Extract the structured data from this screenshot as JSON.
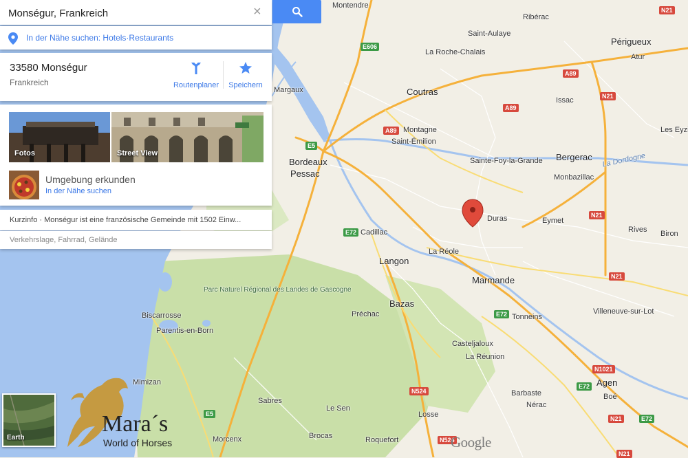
{
  "search": {
    "value": "Monségur, Frankreich",
    "clear_icon": "×"
  },
  "nearby": {
    "text": "In der Nähe suchen: Hotels·Restaurants"
  },
  "place": {
    "title": "33580 Monségur",
    "subtitle": "Frankreich",
    "route_label": "Routenplaner",
    "save_label": "Speichern"
  },
  "media": {
    "photos_label": "Fotos",
    "streetview_label": "Street View",
    "explore_title": "Umgebung erkunden",
    "explore_link": "In der Nähe suchen"
  },
  "info": {
    "text": "Kurzinfo · Monségur ist eine französische Gemeinde mit 1502 Einw..."
  },
  "extra": {
    "text": "Verkehrslage, Fahrrad, Gelände"
  },
  "earth": {
    "label": "Earth"
  },
  "google": {
    "text": "Google"
  },
  "watermark": {
    "title": "Mara´s",
    "subtitle": "World of Horses"
  },
  "map": {
    "cities": {
      "montendre": "Montendre",
      "riberac": "Ribérac",
      "saint_aulaye": "Saint-Aulaye",
      "perigueux": "Périgueux",
      "atur": "Atur",
      "la_roche_chalais": "La Roche-Chalais",
      "margaux": "Margaux",
      "coutras": "Coutras",
      "issac": "Issac",
      "les_eyzies": "Les Eyzi",
      "montagne": "Montagne",
      "saint_emilion": "Saint-Émilion",
      "bordeaux": "Bordeaux",
      "pessac": "Pessac",
      "sainte_foy": "Sainte-Foy-la-Grande",
      "bergerac": "Bergerac",
      "monbazillac": "Monbazillac",
      "la_dordogne": "La Dordogne",
      "duras": "Duras",
      "eymet": "Eymet",
      "cadillac": "Cadillac",
      "rives": "Rives",
      "biron": "Biron",
      "la_reole": "La Réole",
      "langon": "Langon",
      "marmande": "Marmande",
      "parc": "Parc Naturel Régional des Landes de Gascogne",
      "bazas": "Bazas",
      "tonneins": "Tonneins",
      "villeneuve": "Villeneuve-sur-Lot",
      "biscarrosse": "Biscarrosse",
      "prechac": "Préchac",
      "parentis": "Parentis-en-Born",
      "casteljaloux": "Casteljaloux",
      "la_reunion": "La Réunion",
      "mimizan": "Mimizan",
      "agen": "Agen",
      "barbaste": "Barbaste",
      "sabres": "Sabres",
      "le_sen": "Le Sen",
      "boe": "Boé",
      "nerac": "Nérac",
      "losse": "Losse",
      "morcenx": "Morcenx",
      "brocas": "Brocas",
      "roquefort": "Roquefort"
    },
    "roads": {
      "n21a": "N21",
      "e606": "E606",
      "a89a": "A89",
      "n21b": "N21",
      "a89b": "A89",
      "a89c": "A89",
      "e5a": "E5",
      "n21c": "N21",
      "e72a": "E72",
      "n21d": "N21",
      "e72b": "E72",
      "n1021": "N1021",
      "e72c": "E72",
      "n524a": "N524",
      "e5b": "E5",
      "n21e": "N21",
      "e72d": "E72",
      "n524b": "N524",
      "n21f": "N21"
    }
  },
  "colors": {
    "accent": "#4a8af4",
    "link": "#3b78e7",
    "marker": "#e04a3b",
    "water": "#a4c4ef",
    "forest": "#c9dfa8"
  },
  "icons": {
    "search": "search-icon",
    "pin": "pin-icon",
    "route": "route-icon",
    "star": "star-icon",
    "marker": "map-marker-icon"
  }
}
